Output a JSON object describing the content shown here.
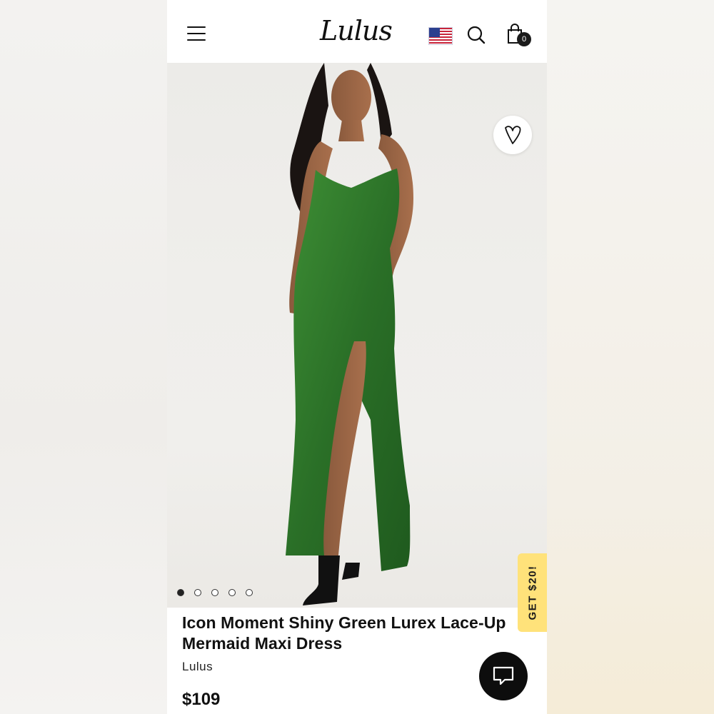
{
  "header": {
    "logo_text": "Lulus",
    "cart_count": "0",
    "menu_icon": "hamburger-menu-icon",
    "flag_icon": "us-flag-icon",
    "search_icon": "search-icon",
    "bag_icon": "shopping-bag-icon"
  },
  "gallery": {
    "image_count": 5,
    "active_index": 0,
    "wishlist_icon": "heart-icon"
  },
  "promo": {
    "label": "GET $20!",
    "color": "#ffe27a"
  },
  "product": {
    "title": "Icon Moment Shiny Green Lurex Lace-Up Mermaid Maxi Dress",
    "brand": "Lulus",
    "price": "$109",
    "dress_color": "#2f7a2c"
  },
  "chat": {
    "icon": "chat-bubble-icon"
  }
}
